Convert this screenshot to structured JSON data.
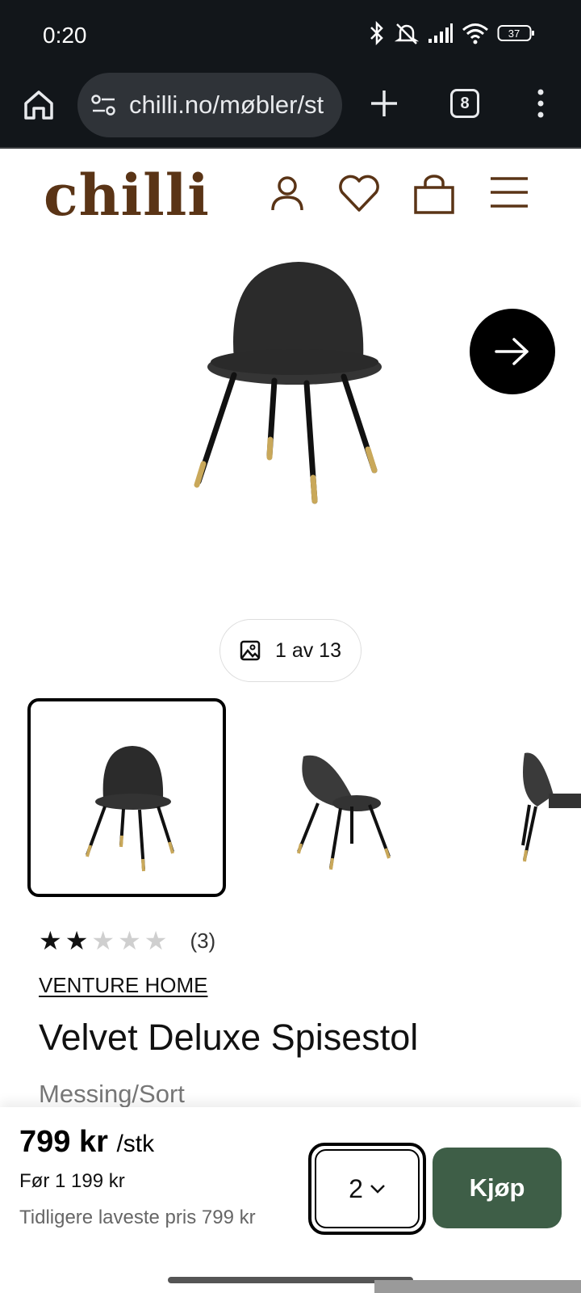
{
  "status": {
    "time": "0:20",
    "battery": "37"
  },
  "browser": {
    "url": "chilli.no/møbler/st",
    "tab_count": "8"
  },
  "site": {
    "logo": "chilli"
  },
  "gallery": {
    "counter": "1 av 13"
  },
  "product": {
    "rating": 2,
    "rating_max": 5,
    "review_count": "(3)",
    "brand": "VENTURE HOME",
    "title": "Velvet Deluxe Spisestol",
    "variant": "Messing/Sort"
  },
  "buy": {
    "price": "799 kr",
    "unit": "/stk",
    "previous_price": "Før 1 199 kr",
    "lowest_price": "Tidligere laveste pris 799 kr",
    "quantity": "2",
    "buy_label": "Kjøp"
  },
  "colors": {
    "brand_brown": "#5a3416",
    "buy_green": "#3e5e47",
    "chrome_dark": "#12161a"
  }
}
